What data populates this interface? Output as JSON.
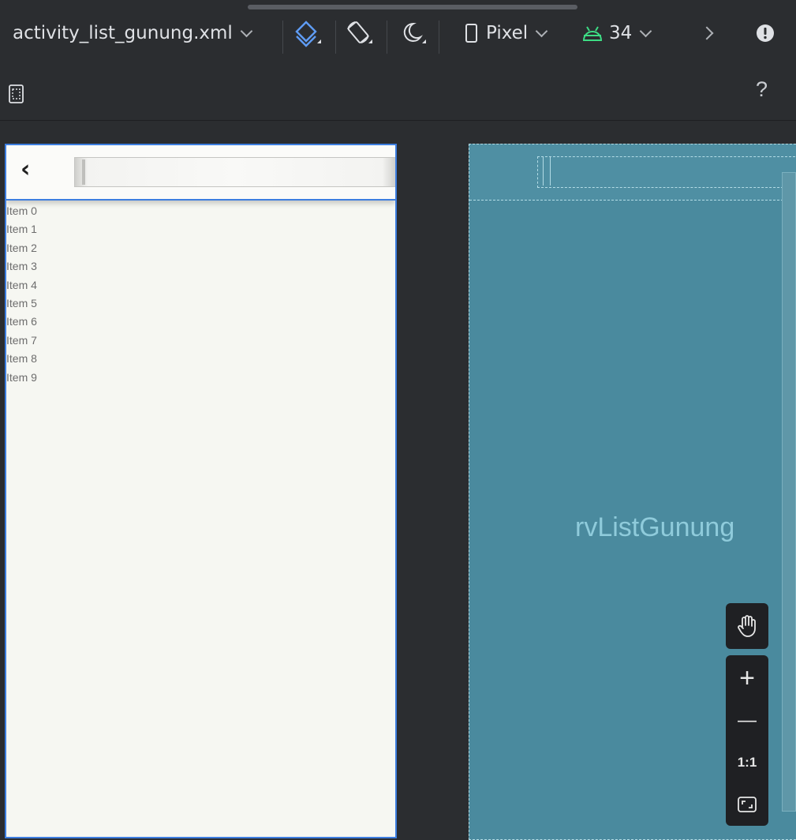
{
  "toolbar": {
    "file_name": "activity_list_gunung.xml",
    "device": "Pixel",
    "api_level": "34",
    "accent_colors": {
      "layers": "#5f9cf5",
      "android": "#3ddc84"
    },
    "icons": [
      "layers-icon",
      "rotate-icon",
      "night-mode-icon",
      "phone-icon",
      "android-icon",
      "chevron-right-icon",
      "warning-icon"
    ]
  },
  "toolbar2": {
    "help": "?",
    "icons": [
      "select-frame-icon"
    ]
  },
  "design": {
    "items": [
      "Item 0",
      "Item 1",
      "Item 2",
      "Item 3",
      "Item 4",
      "Item 5",
      "Item 6",
      "Item 7",
      "Item 8",
      "Item 9"
    ],
    "back_glyph": "‹"
  },
  "blueprint": {
    "label": "rvListGunung"
  },
  "zoom": {
    "zoom_in": "+",
    "zoom_out": "—",
    "reset": "1:1",
    "icons": [
      "pan-hand-icon",
      "fit-screen-icon"
    ]
  }
}
